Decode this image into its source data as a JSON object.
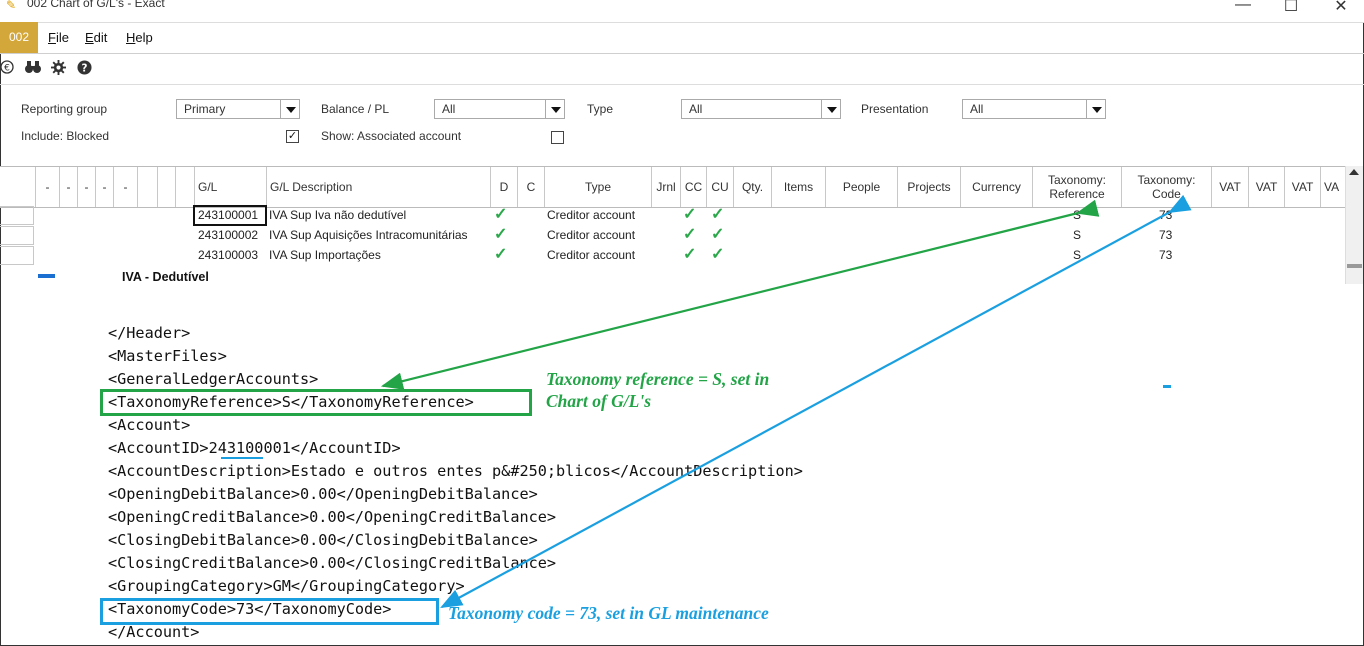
{
  "window": {
    "title": "002 Chart of G/L's - Exact",
    "minimize": "—",
    "maximize": "☐",
    "close": "✕"
  },
  "menubar": {
    "company": "002",
    "items": [
      {
        "hot": "F",
        "rest": "ile"
      },
      {
        "hot": "E",
        "rest": "dit"
      },
      {
        "hot": "H",
        "rest": "elp"
      }
    ]
  },
  "toolbar": {
    "icons": [
      "euro-icon",
      "binoculars-icon",
      "gear-icon",
      "help-icon"
    ]
  },
  "filters": {
    "reporting_group_label": "Reporting group",
    "reporting_group_value": "Primary",
    "balance_pl_label": "Balance / PL",
    "balance_pl_value": "All",
    "type_label": "Type",
    "type_value": "All",
    "presentation_label": "Presentation",
    "presentation_value": "All",
    "include_blocked_label": "Include: Blocked",
    "include_blocked_checked": "✓",
    "show_associated_label": "Show: Associated account",
    "show_associated_checked": ""
  },
  "grid": {
    "columns": {
      "d1": "-",
      "d2": "-",
      "d3": "-",
      "d4": "-",
      "d5": "-",
      "gl": "G/L",
      "desc": "G/L Description",
      "d": "D",
      "c": "C",
      "type": "Type",
      "jrnl": "Jrnl",
      "cc": "CC",
      "cu": "CU",
      "qty": "Qty.",
      "items": "Items",
      "people": "People",
      "projects": "Projects",
      "currency": "Currency",
      "tax_ref_1": "Taxonomy:",
      "tax_ref_2": "Reference",
      "tax_code_1": "Taxonomy:",
      "tax_code_2": "Code",
      "vat1": "VAT",
      "vat2": "VAT",
      "vat3": "VAT",
      "vat4": "VA"
    },
    "rows": [
      {
        "gl": "243100001",
        "desc": "IVA Sup Iva não dedutível",
        "d": "✓",
        "type": "Creditor account",
        "cc": "✓",
        "cu": "✓",
        "tax_ref": "S",
        "tax_code": "73"
      },
      {
        "gl": "243100002",
        "desc": "IVA Sup Aquisições Intracomunitárias",
        "d": "✓",
        "type": "Creditor account",
        "cc": "✓",
        "cu": "✓",
        "tax_ref": "S",
        "tax_code": "73"
      },
      {
        "gl": "243100003",
        "desc": "IVA Sup Importações",
        "d": "✓",
        "type": "Creditor account",
        "cc": "✓",
        "cu": "✓",
        "tax_ref": "S",
        "tax_code": "73"
      }
    ],
    "group_label": "IVA - Dedutível"
  },
  "xml": {
    "lines": [
      "</Header>",
      "<MasterFiles>",
      "<GeneralLedgerAccounts>",
      "<TaxonomyReference>S</TaxonomyReference>",
      "<Account>",
      "<AccountID>243100001</AccountID>",
      "<AccountDescription>Estado e outros entes p&#250;blicos</AccountDescription>",
      "<OpeningDebitBalance>0.00</OpeningDebitBalance>",
      "<OpeningCreditBalance>0.00</OpeningCreditBalance>",
      "<ClosingDebitBalance>0.00</ClosingDebitBalance>",
      "<ClosingCreditBalance>0.00</ClosingCreditBalance>",
      "<GroupingCategory>GM</GroupingCategory>",
      "<TaxonomyCode>73</TaxonomyCode>",
      "</Account>"
    ]
  },
  "annotations": {
    "green_line1": "Taxonomy reference = S, set in",
    "green_line2": "Chart of G/L's",
    "blue": "Taxonomy code = 73, set in GL maintenance",
    "green_color": "#22a447",
    "blue_color": "#1aa0e0"
  }
}
